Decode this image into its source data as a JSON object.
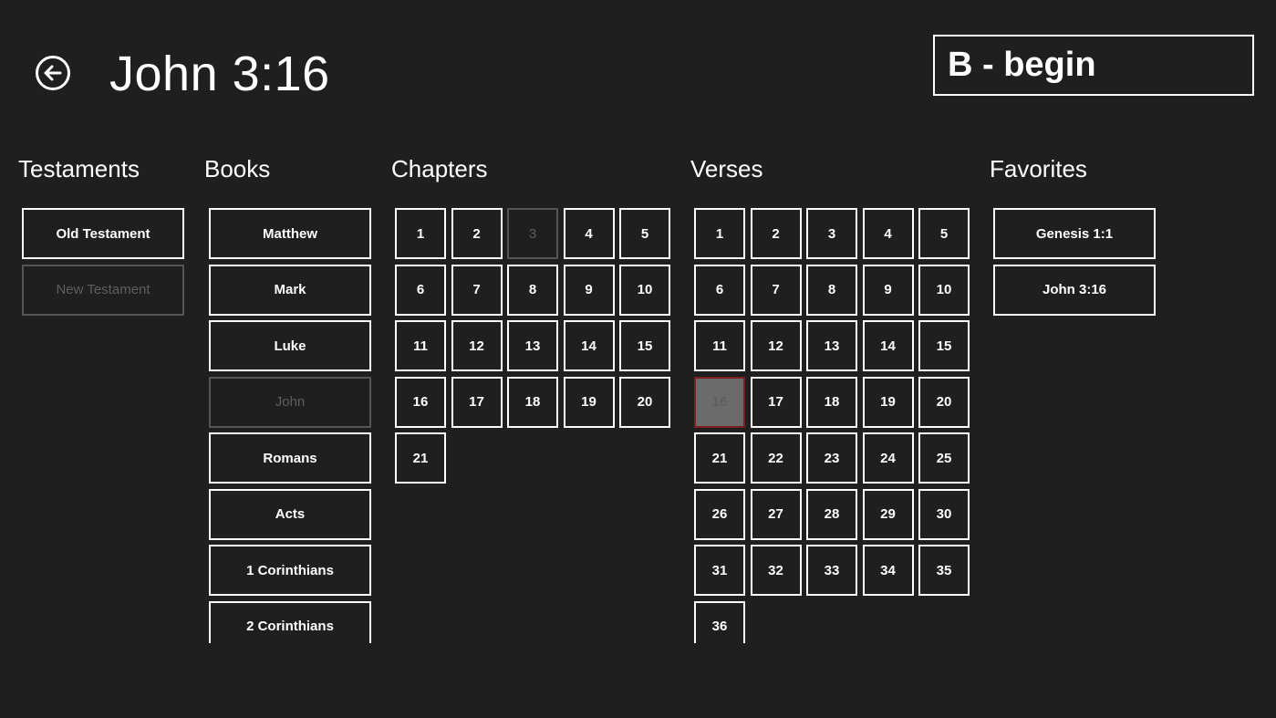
{
  "header": {
    "title": "John 3:16",
    "search_value": "B - begin"
  },
  "sections": {
    "testaments": "Testaments",
    "books": "Books",
    "chapters": "Chapters",
    "verses": "Verses",
    "favorites": "Favorites"
  },
  "testaments": [
    {
      "label": "Old Testament",
      "state": "normal"
    },
    {
      "label": "New Testament",
      "state": "disabled"
    }
  ],
  "books": [
    {
      "label": "Matthew",
      "state": "normal"
    },
    {
      "label": "Mark",
      "state": "normal"
    },
    {
      "label": "Luke",
      "state": "normal"
    },
    {
      "label": "John",
      "state": "disabled"
    },
    {
      "label": "Romans",
      "state": "normal"
    },
    {
      "label": "Acts",
      "state": "normal"
    },
    {
      "label": "1 Corinthians",
      "state": "normal"
    },
    {
      "label": "2 Corinthians",
      "state": "normal"
    }
  ],
  "chapters": {
    "count": 21,
    "current": 3
  },
  "verses": {
    "count": 36,
    "selected": 16
  },
  "favorites": [
    {
      "label": "Genesis 1:1"
    },
    {
      "label": "John 3:16"
    }
  ],
  "icons": {
    "back": "back-arrow-icon"
  }
}
